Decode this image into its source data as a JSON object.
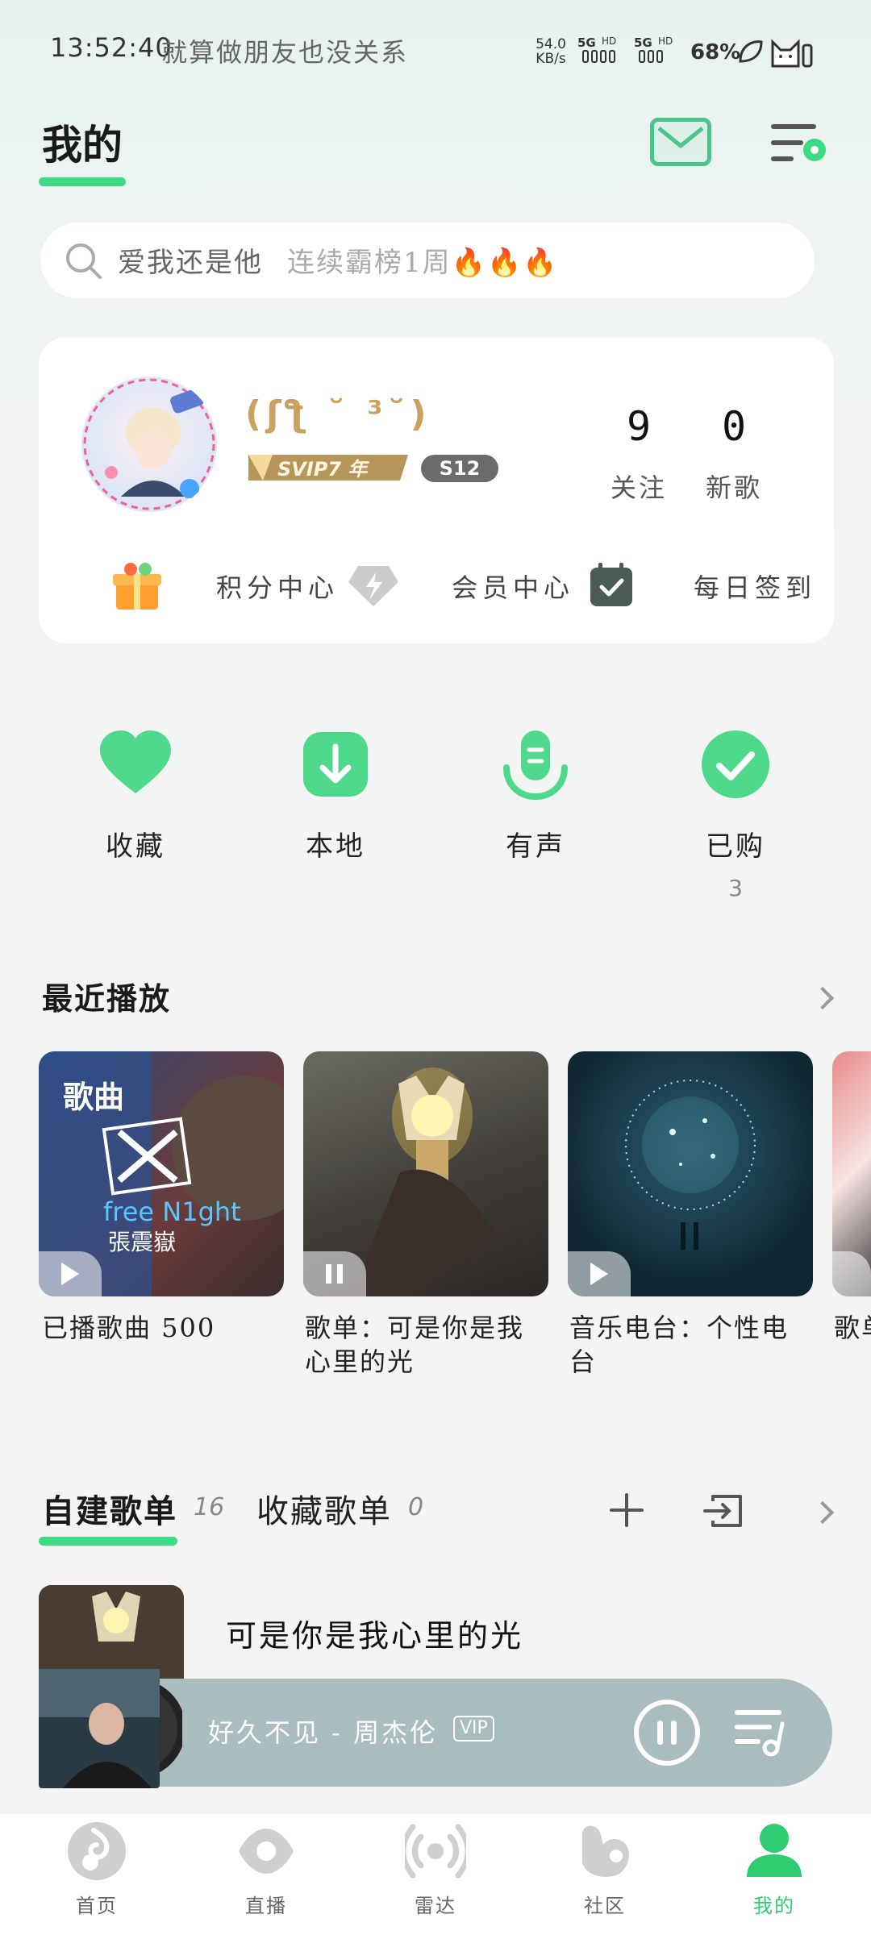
{
  "status_bar": {
    "time": "13:52:40",
    "lyric": "就算做朋友也没关系",
    "net_speed_value": "54.0",
    "net_speed_unit": "KB/s",
    "signal_1": "5G",
    "signal_2": "5G",
    "hd_label": "HD",
    "battery": "68%"
  },
  "header": {
    "title": "我的",
    "accent_color": "#3ddc84"
  },
  "search": {
    "query_text": "爱我还是他",
    "hint_text": "连续霸榜1周🔥🔥🔥"
  },
  "profile": {
    "nickname": "(ʃƪ ˘ ³˘)",
    "vip_badge": "SVIP7 年",
    "level_badge": "S12",
    "following_count": "9",
    "following_label": "关注",
    "new_songs_count": "0",
    "new_songs_label": "新歌",
    "quick_links": [
      {
        "label": "积分中心",
        "icon": "gift-icon"
      },
      {
        "label": "会员中心",
        "icon": "diamond-icon"
      },
      {
        "label": "每日签到",
        "icon": "calendar-check-icon"
      }
    ]
  },
  "shortcuts": [
    {
      "label": "收藏",
      "icon": "heart-icon",
      "count": ""
    },
    {
      "label": "本地",
      "icon": "download-icon",
      "count": ""
    },
    {
      "label": "有声",
      "icon": "microphone-icon",
      "count": ""
    },
    {
      "label": "已购",
      "icon": "check-icon",
      "count": "3"
    }
  ],
  "recent": {
    "title": "最近播放",
    "tiles": [
      {
        "overlay": "歌曲",
        "caption": "已播歌曲 500",
        "cover_text": "free N1ght",
        "cover_sub": "張震嶽"
      },
      {
        "overlay": "",
        "caption": "歌单：可是你是我心里的光"
      },
      {
        "overlay": "",
        "caption": "音乐电台：个性电台"
      },
      {
        "overlay": "",
        "caption": "歌单"
      }
    ]
  },
  "playlists": {
    "tab_created": "自建歌单",
    "tab_created_count": "16",
    "tab_collected": "收藏歌单",
    "tab_collected_count": "0",
    "first_item_title": "可是你是我心里的光"
  },
  "player": {
    "song": "好久不见 - 周杰伦",
    "vip_label": "VIP"
  },
  "nav": [
    {
      "label": "首页",
      "icon": "music-note-icon"
    },
    {
      "label": "直播",
      "icon": "eye-icon"
    },
    {
      "label": "雷达",
      "icon": "radar-icon"
    },
    {
      "label": "社区",
      "icon": "community-icon"
    },
    {
      "label": "我的",
      "icon": "user-icon",
      "active": true
    }
  ]
}
